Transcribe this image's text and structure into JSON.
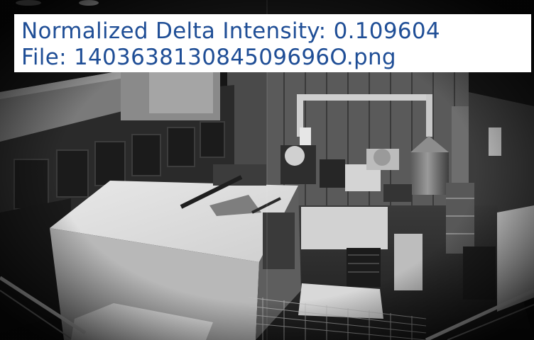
{
  "overlay": {
    "intensity_label": "Normalized Delta Intensity:",
    "intensity_value": "0.109604",
    "file_label": "File:",
    "file_name": "140363813084509696O.png"
  },
  "colors": {
    "overlay_text": "#1f4e96",
    "overlay_background": "#ffffff"
  }
}
